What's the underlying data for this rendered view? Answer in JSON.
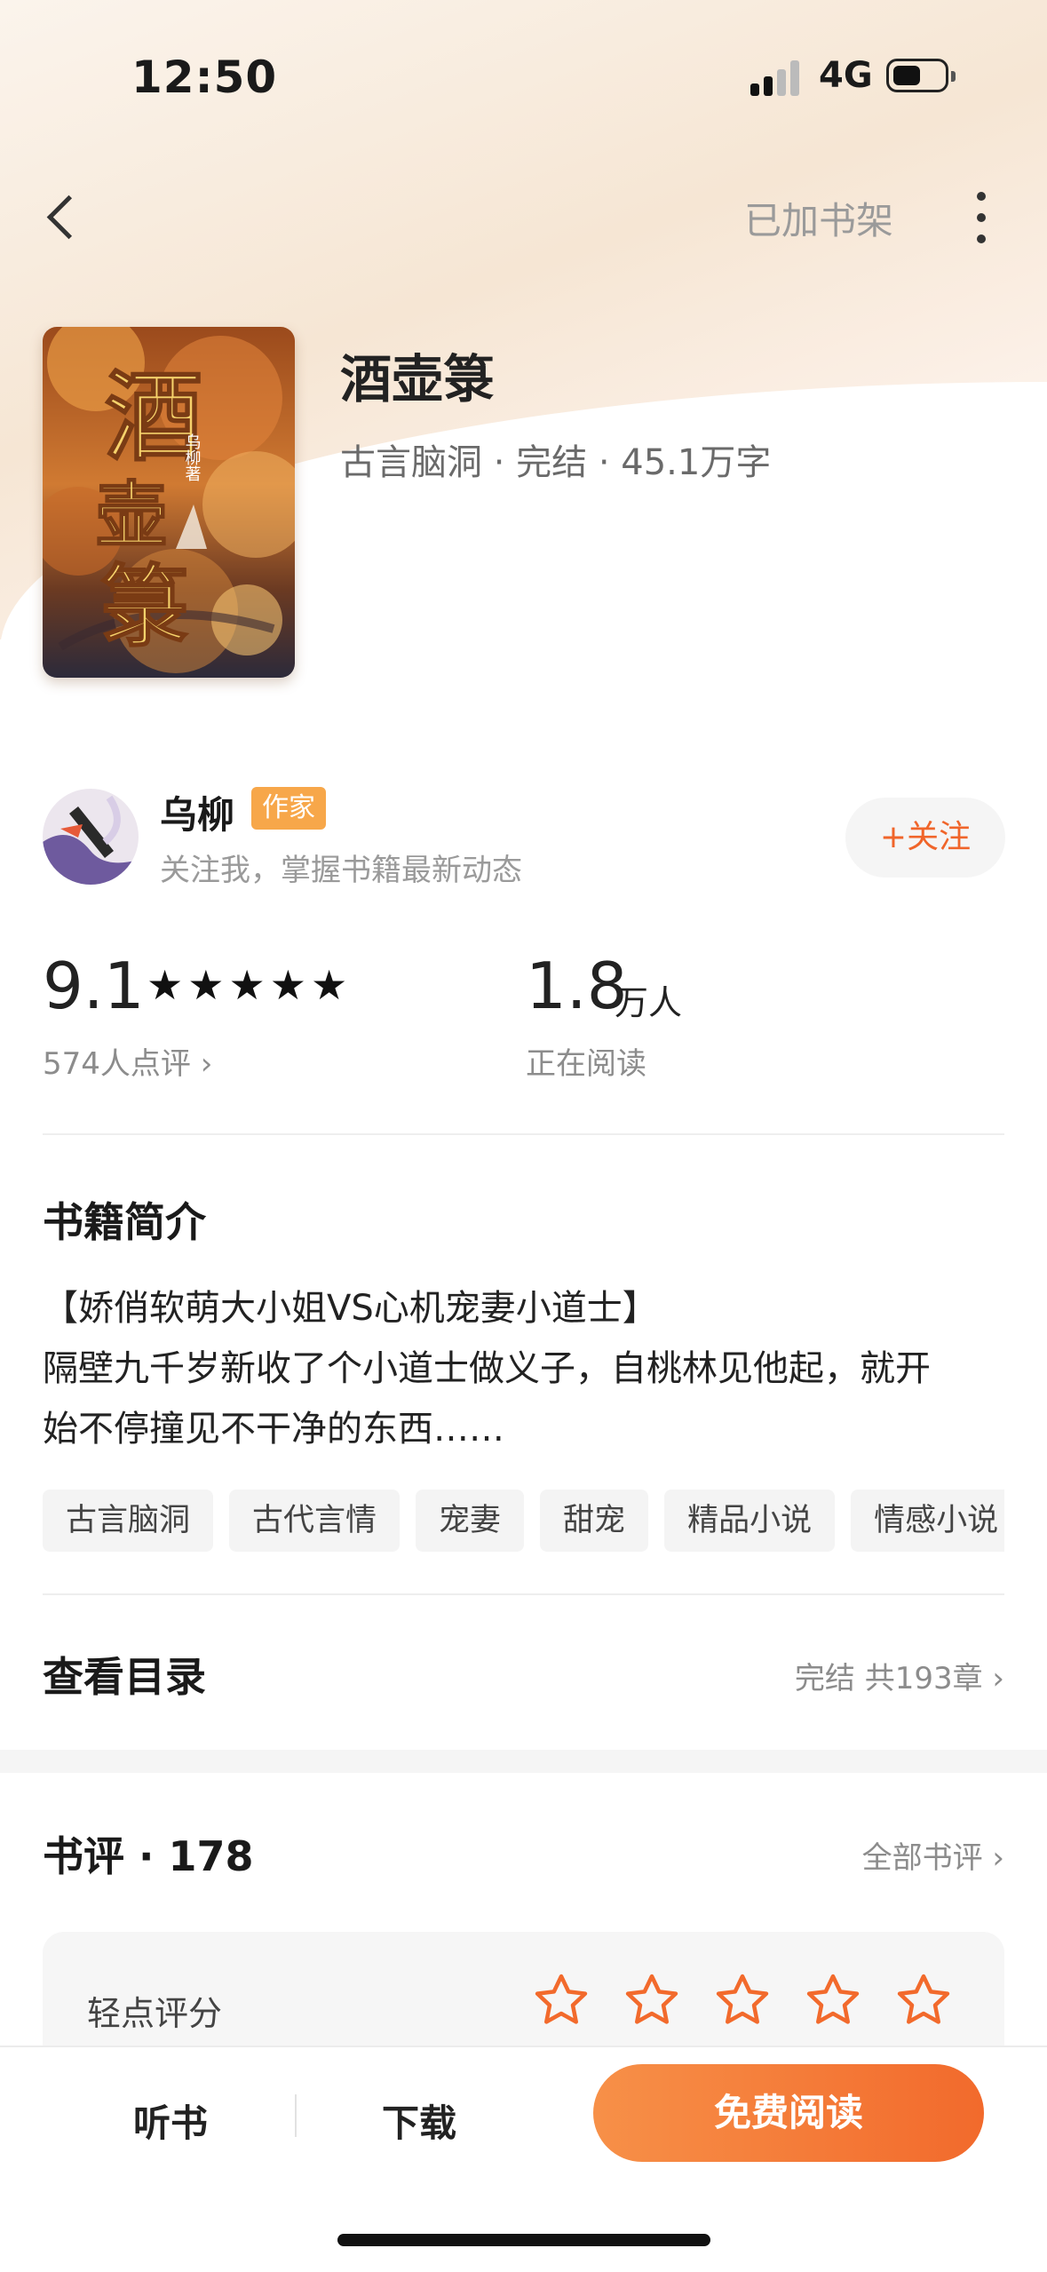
{
  "status_bar": {
    "time": "12:50",
    "network": "4G"
  },
  "nav": {
    "shelf_status": "已加书架"
  },
  "book": {
    "title": "酒壶箓",
    "meta": "古言脑洞 · 完结 · 45.1万字",
    "cover_title": "酒壶箓",
    "cover_author": "乌柳 著"
  },
  "author": {
    "name": "乌柳",
    "badge": "作家",
    "description": "关注我，掌握书籍最新动态",
    "follow_label": "+关注"
  },
  "stats": {
    "rating": "9.1",
    "stars": 5,
    "rating_count": "574人点评 ›",
    "reading_value": "1.8",
    "reading_unit": "万人",
    "reading_label": "正在阅读"
  },
  "synopsis": {
    "title": "书籍简介",
    "lines": [
      "【娇俏软萌大小姐VS心机宠妻小道士】",
      "隔壁九千岁新收了个小道士做义子，自桃林见他起，就开",
      "始不停撞见不干净的东西……"
    ]
  },
  "tags": [
    "古言脑洞",
    "古代言情",
    "宠妻",
    "甜宠",
    "精品小说",
    "情感小说"
  ],
  "catalog": {
    "label": "查看目录",
    "info": "完结 共193章 ›"
  },
  "reviews": {
    "title": "书评 · 178",
    "all_label": "全部书评 ›",
    "rate_label": "轻点评分",
    "rate_star_count": 5
  },
  "bottom_bar": {
    "listen": "听书",
    "download": "下载",
    "read": "免费阅读"
  },
  "colors": {
    "accent": "#f26a2c",
    "badge": "#f7a74a",
    "hero_tint": "#f6e6d4"
  }
}
